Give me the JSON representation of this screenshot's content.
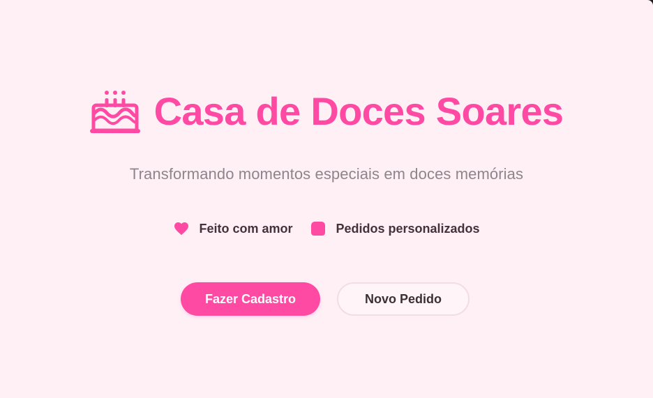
{
  "brand": {
    "title": "Casa de Doces Soares",
    "icon": "birthday-cake-icon"
  },
  "tagline": "Transformando momentos especiais em doces memórias",
  "features": [
    {
      "icon": "heart-icon",
      "label": "Feito com amor"
    },
    {
      "icon": "custom-order-icon",
      "label": "Pedidos personalizados"
    }
  ],
  "actions": {
    "primary_label": "Fazer Cadastro",
    "secondary_label": "Novo Pedido"
  },
  "colors": {
    "accent": "#ff4aa3",
    "background": "#fff0f6",
    "text_dark": "#43323a",
    "text_muted": "#8e858a",
    "button_border": "#f2dce6"
  }
}
